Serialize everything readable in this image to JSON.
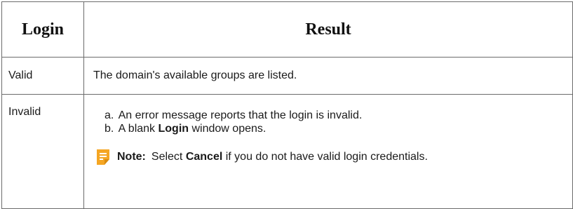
{
  "table": {
    "headers": {
      "login": "Login",
      "result": "Result"
    },
    "rows": [
      {
        "login": "Valid",
        "result": "The domain's available groups are listed."
      },
      {
        "login": "Invalid",
        "steps": [
          {
            "marker": "a.",
            "text": "An error message reports that the login is invalid."
          },
          {
            "marker": "b.",
            "before": "A blank",
            "bold": "Login",
            "after": "window opens."
          }
        ],
        "note": {
          "icon": "note-icon",
          "label": "Note:",
          "before": "Select",
          "bold": "Cancel",
          "after": "if you do not have valid login credentials."
        }
      }
    ]
  },
  "colors": {
    "border": "#6b6b6b",
    "note_icon": "#f5a623",
    "text": "#1a1a1a"
  }
}
